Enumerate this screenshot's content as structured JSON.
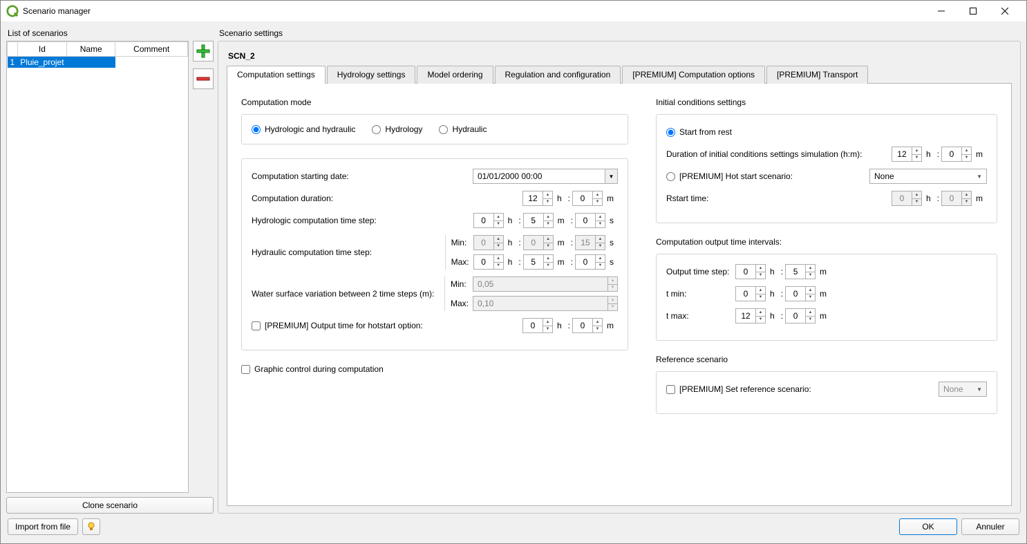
{
  "window": {
    "title": "Scenario manager"
  },
  "left": {
    "list_title": "List of scenarios",
    "headers": {
      "id": "Id",
      "name": "Name",
      "comment": "Comment"
    },
    "row": {
      "num": "1",
      "name": "Pluie_projet",
      "comment": ""
    },
    "clone": "Clone scenario"
  },
  "right": {
    "title": "Scenario settings",
    "scn": "SCN_2",
    "tabs": {
      "t0": "Computation settings",
      "t1": "Hydrology settings",
      "t2": "Model ordering",
      "t3": "Regulation and configuration",
      "t4": "[PREMIUM] Computation options",
      "t5": "[PREMIUM] Transport"
    },
    "comp_mode": {
      "title": "Computation mode",
      "r0": "Hydrologic and hydraulic",
      "r1": "Hydrology",
      "r2": "Hydraulic"
    },
    "params": {
      "start_date_label": "Computation starting date:",
      "start_date": "01/01/2000 00:00",
      "duration_label": "Computation duration:",
      "duration_h": "12",
      "duration_m": "0",
      "hydro_step_label": "Hydrologic computation time step:",
      "hydro_h": "0",
      "hydro_m": "5",
      "hydro_s": "0",
      "hydra_step_label": "Hydraulic computation time step:",
      "hydra_min_h": "0",
      "hydra_min_m": "0",
      "hydra_min_s": "15",
      "hydra_max_h": "0",
      "hydra_max_m": "5",
      "hydra_max_s": "0",
      "wsv_label": "Water surface variation between 2 time steps (m):",
      "wsv_min": "0,05",
      "wsv_max": "0,10",
      "hotstart_out_label": "[PREMIUM] Output time for hotstart option:",
      "hotstart_h": "0",
      "hotstart_m": "0",
      "min_label": "Min:",
      "max_label": "Max:"
    },
    "graphic": "Graphic control during computation",
    "init": {
      "title": "Initial conditions settings",
      "rest": "Start from rest",
      "dur_label": "Duration of initial conditions settings simulation (h:m):",
      "dur_h": "12",
      "dur_m": "0",
      "hot_label": "[PREMIUM] Hot start scenario:",
      "hot_select": "None",
      "rstart_label": "Rstart time:",
      "rstart_h": "0",
      "rstart_m": "0"
    },
    "output": {
      "title": "Computation output time intervals:",
      "step_label": "Output time step:",
      "step_h": "0",
      "step_m": "5",
      "tmin_label": "t min:",
      "tmin_h": "0",
      "tmin_m": "0",
      "tmax_label": "t max:",
      "tmax_h": "12",
      "tmax_m": "0"
    },
    "ref": {
      "title": "Reference scenario",
      "label": "[PREMIUM] Set reference scenario:",
      "select": "None"
    }
  },
  "units": {
    "h": "h",
    "m": "m",
    "s": "s",
    "colon": ":"
  },
  "bottom": {
    "import": "Import from file",
    "ok": "OK",
    "cancel": "Annuler",
    "help": "?"
  }
}
